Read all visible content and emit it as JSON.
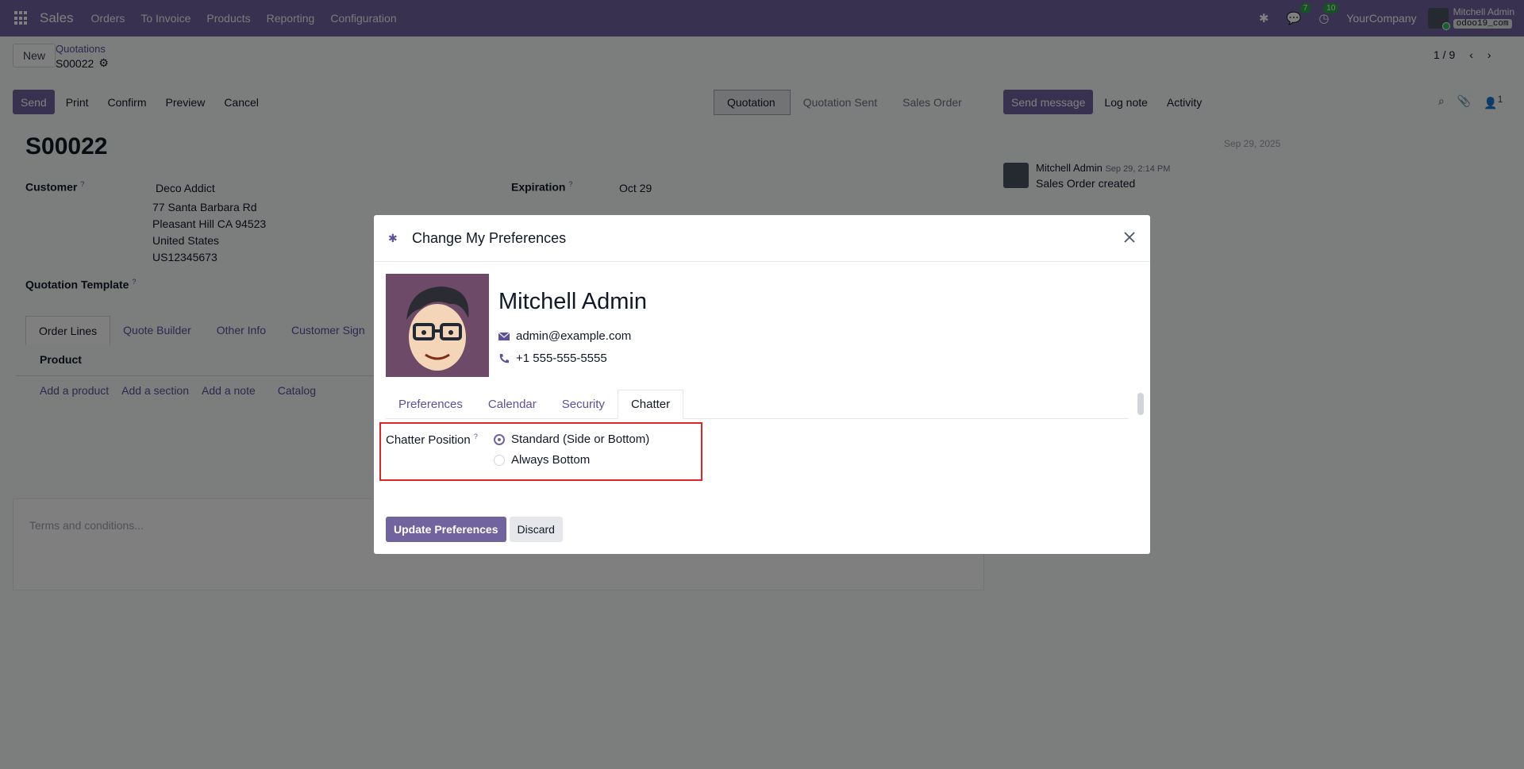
{
  "navbar": {
    "brand": "Sales",
    "menu": [
      "Orders",
      "To Invoice",
      "Products",
      "Reporting",
      "Configuration"
    ],
    "messages_badge": "7",
    "activities_badge": "10",
    "company": "YourCompany",
    "user_name": "Mitchell Admin",
    "db_name": "odoo19_com"
  },
  "control_panel": {
    "new_label": "New",
    "breadcrumb": "Quotations",
    "record_name": "S00022",
    "pager": "1 / 9"
  },
  "actions": [
    "Send",
    "Print",
    "Confirm",
    "Preview",
    "Cancel"
  ],
  "statusbar": [
    "Quotation",
    "Quotation Sent",
    "Sales Order"
  ],
  "chatter_actions": [
    "Send message",
    "Log note",
    "Activity"
  ],
  "followers_count": "1",
  "form": {
    "title": "S00022",
    "customer_label": "Customer",
    "customer_name": "Deco Addict",
    "address_line1": "77 Santa Barbara Rd",
    "address_line2": "Pleasant Hill CA 94523",
    "address_line3": "United States",
    "vat": "US12345673",
    "template_label": "Quotation Template",
    "expiration_label": "Expiration",
    "expiration_value": "Oct 29",
    "tabs": [
      "Order Lines",
      "Quote Builder",
      "Other Info",
      "Customer Sign"
    ],
    "table_header": "Product",
    "add_links": [
      "Add a product",
      "Add a section",
      "Add a note",
      "Catalog"
    ],
    "terms_placeholder": "Terms and conditions..."
  },
  "chatter": {
    "date": "Sep 29, 2025",
    "author": "Mitchell Admin",
    "time": "Sep 29, 2:14 PM",
    "body": "Sales Order created"
  },
  "modal": {
    "title": "Change My Preferences",
    "name": "Mitchell Admin",
    "email": "admin@example.com",
    "phone": "+1 555-555-5555",
    "tabs": [
      "Preferences",
      "Calendar",
      "Security",
      "Chatter"
    ],
    "field_label": "Chatter Position",
    "options": [
      "Standard (Side or Bottom)",
      "Always Bottom"
    ],
    "selected_option": "Standard (Side or Bottom)",
    "update_label": "Update Preferences",
    "discard_label": "Discard"
  },
  "colors": {
    "brand": "#71639e",
    "highlight": "#dc2626"
  },
  "help_mark": "?"
}
